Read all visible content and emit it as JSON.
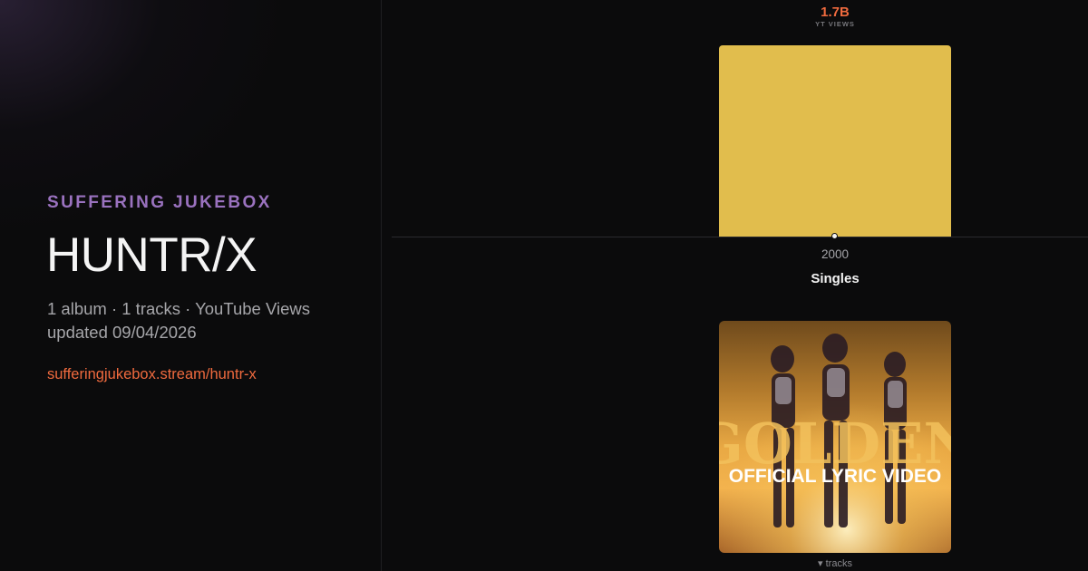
{
  "site": {
    "brand": "SUFFERING JUKEBOX",
    "link": "sufferingjukebox.stream/huntr-x"
  },
  "artist": {
    "name": "HUNTR/X",
    "summary": "1 album · 1 tracks · YouTube Views",
    "updated": "updated 09/04/2026"
  },
  "stat": {
    "value": "1.7B",
    "label": "YT VIEWS"
  },
  "chart_data": {
    "type": "bar",
    "categories": [
      "2000"
    ],
    "values": [
      1.7
    ],
    "ylim": [
      0,
      1.7
    ]
  },
  "section": {
    "title": "Singles"
  },
  "cover": {
    "title_art": "GOLDEN",
    "subtitle_art": "OFFICIAL LYRIC VIDEO"
  },
  "tracks_toggle": "▾ tracks",
  "colors": {
    "accent": "#ef6a3e",
    "brand": "#9a72bf",
    "bar": "#e1bd4d",
    "background": "#0b0b0c"
  }
}
